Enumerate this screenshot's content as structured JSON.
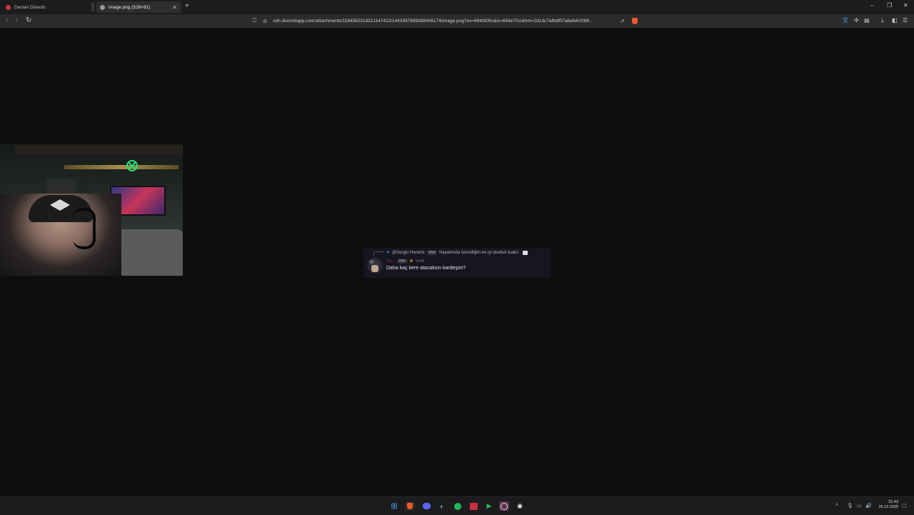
{
  "browser": {
    "tabs": [
      {
        "title": "Declan Diavolo",
        "favicon_color": "#d0343b"
      },
      {
        "title": "image.png (528×91)",
        "favicon_color": "#9a9a9a",
        "active": true
      }
    ],
    "address_bar": {
      "url": "cdn.discordapp.com/attachments/1184562318521147422/1443397699398406174/image.png?ex=694fd09c&is=694e7f1c&hm=2d13c7afbdf07a8afe61f36f..."
    }
  },
  "message": {
    "reply": {
      "author": "@Sergio Hendrix",
      "tag": "VNY",
      "text": "Hayatımda özendiğim en iyi dostluk budur"
    },
    "author": "Fla...",
    "tag": "VNY",
    "time": "14:08",
    "content": "Daha kaç kere atacaksın kardeşim?"
  },
  "taskbar": {
    "clock_time": "21:43",
    "clock_date": "26.12.2025",
    "apps": [
      "windows-start",
      "brave",
      "discord",
      "steam",
      "spotify",
      "calendar-app",
      "arrow-app",
      "obs",
      "media-player"
    ]
  }
}
